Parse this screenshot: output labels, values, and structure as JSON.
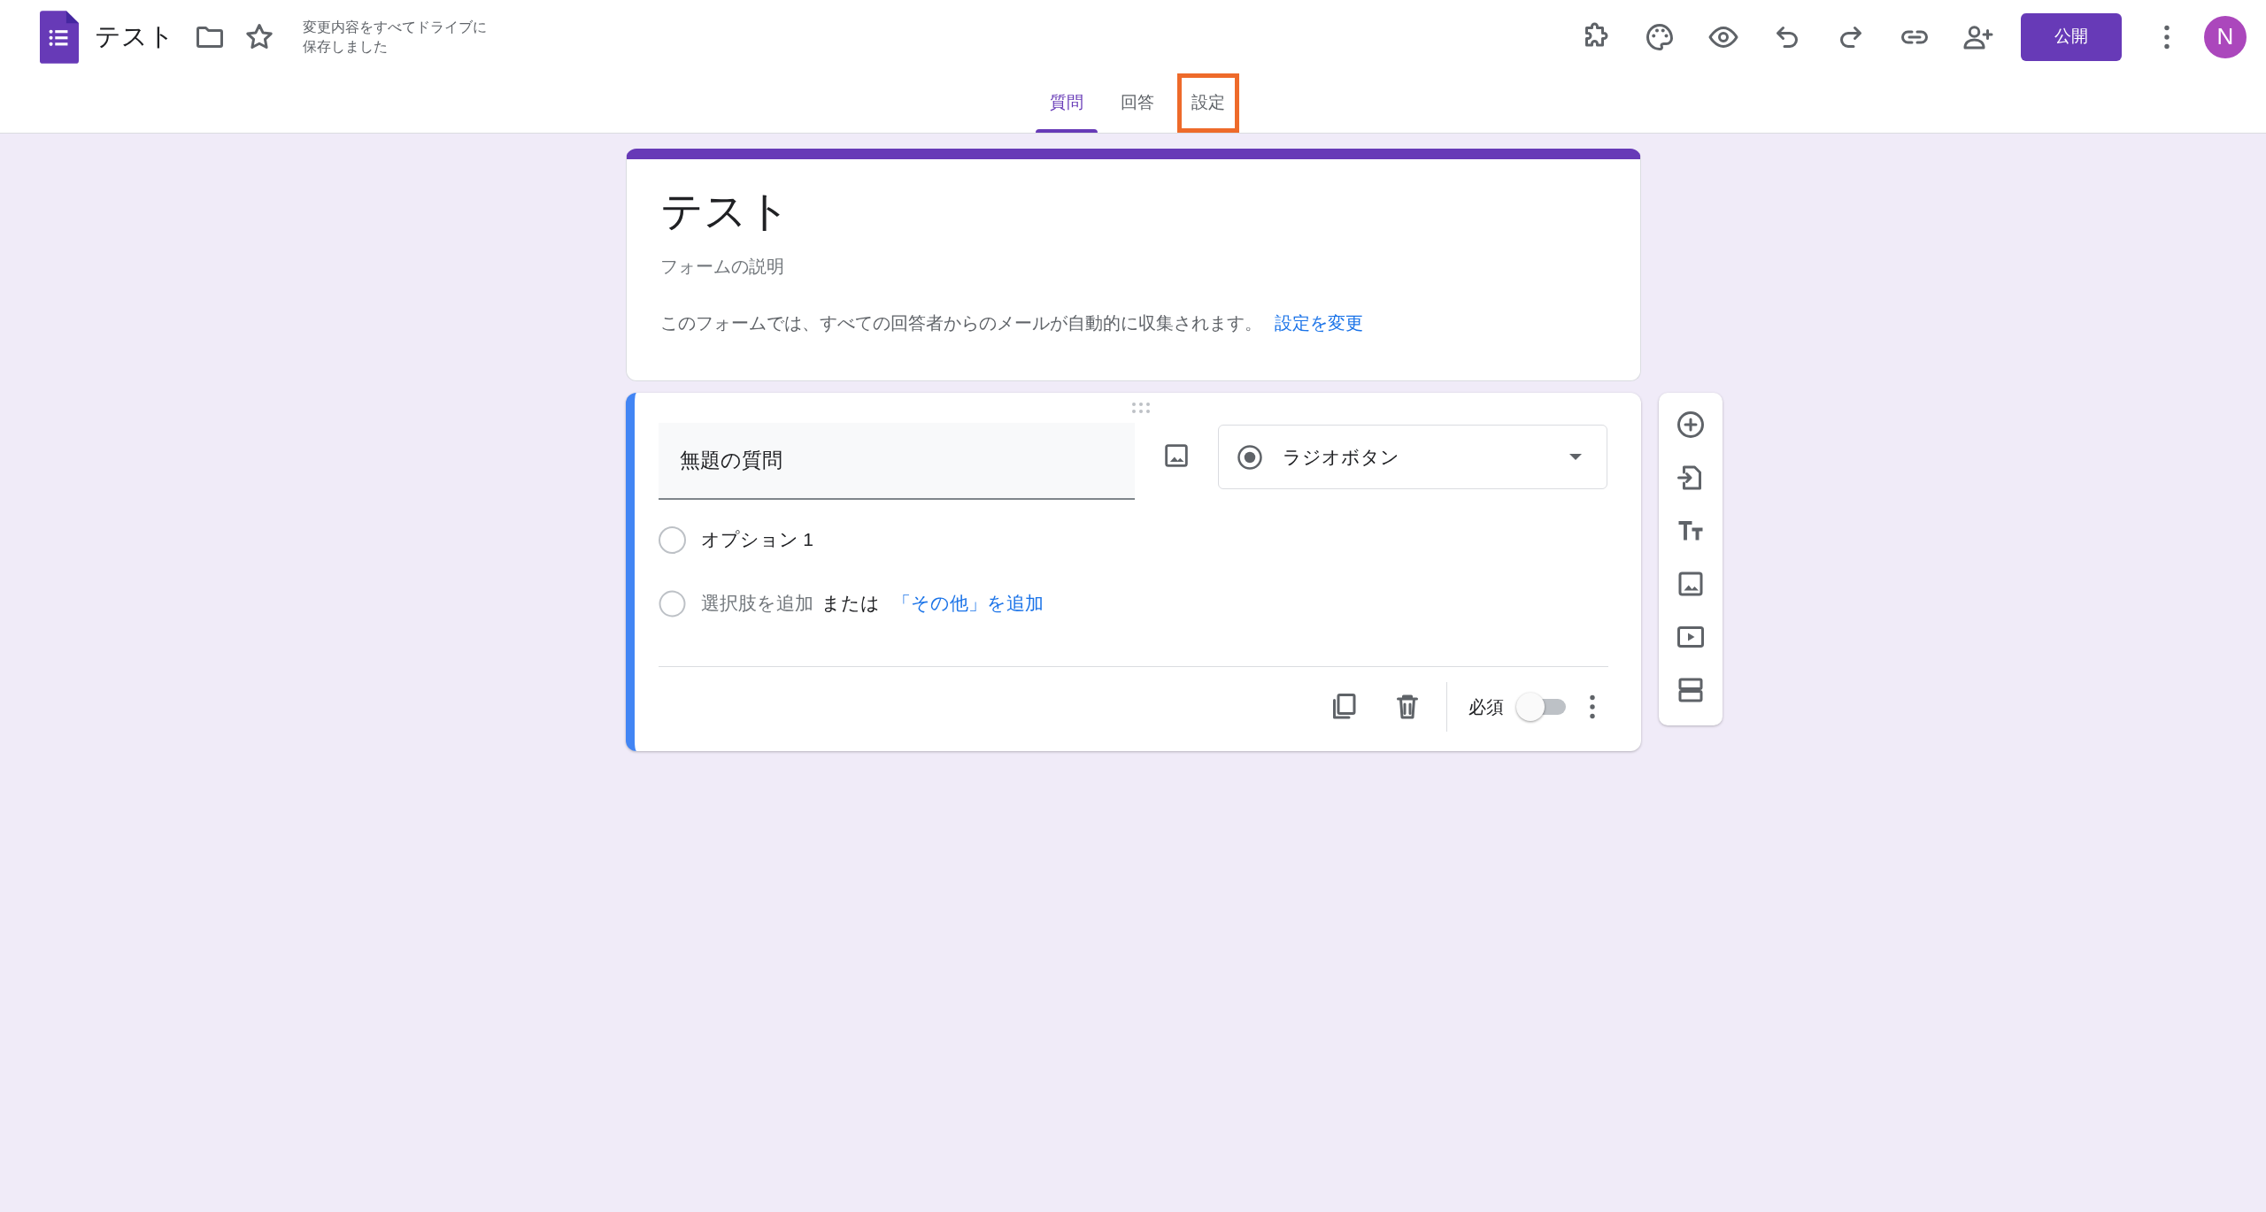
{
  "header": {
    "title": "テスト",
    "save_status": "変更内容をすべてドライブに保存しました",
    "publish_button": "公開",
    "avatar_letter": "N"
  },
  "tabs": [
    {
      "label": "質問",
      "selected": true,
      "highlighted": false
    },
    {
      "label": "回答",
      "selected": false,
      "highlighted": false
    },
    {
      "label": "設定",
      "selected": false,
      "highlighted": true
    }
  ],
  "form_header": {
    "title": "テスト",
    "description_placeholder": "フォームの説明",
    "email_notice": "このフォームでは、すべての回答者からのメールが自動的に収集されます。",
    "settings_link": "設定を変更"
  },
  "question": {
    "title": "無題の質問",
    "type": "ラジオボタン",
    "options": [
      {
        "label": "オプション 1",
        "checked": false
      }
    ],
    "add_option": "選択肢を追加",
    "or_text": "または",
    "add_other": "「その他」を追加",
    "required_label": "必須",
    "required": false
  }
}
